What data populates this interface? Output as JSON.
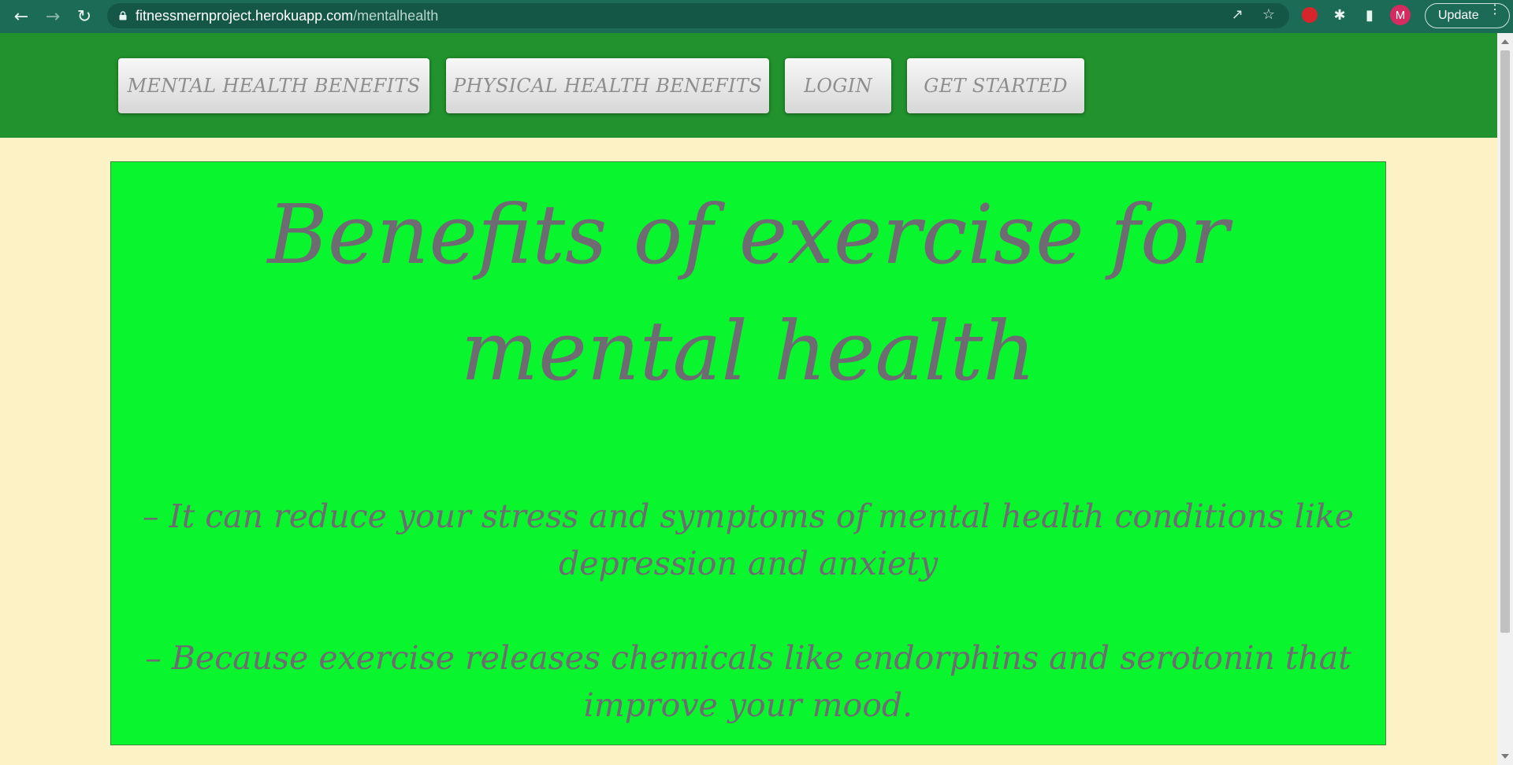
{
  "browser": {
    "url_domain": "fitnessmernproject.herokuapp.com",
    "url_path": "/mentalhealth",
    "avatar_letter": "M",
    "update_label": "Update",
    "icons": [
      "back-icon",
      "forward-icon",
      "reload-icon",
      "lock-icon",
      "share-icon",
      "star-icon",
      "extension-red-icon",
      "puzzle-icon",
      "sidepanel-icon",
      "menu-dots-icon"
    ]
  },
  "nav": {
    "buttons": [
      {
        "label": "MENTAL HEALTH BENEFITS"
      },
      {
        "label": "PHYSICAL HEALTH BENEFITS"
      },
      {
        "label": "LOGIN"
      },
      {
        "label": "GET STARTED"
      }
    ]
  },
  "main": {
    "title": "Benefits of exercise for mental health",
    "benefits": [
      "– It can reduce your stress and symptoms of mental health conditions like depression and anxiety",
      "– Because exercise releases chemicals like endorphins and serotonin that improve your mood."
    ]
  },
  "colors": {
    "chrome_bg": "#1c6b56",
    "nav_bg": "#21922d",
    "page_bg": "#fdf1c6",
    "card_bg": "#09f52d",
    "text_gray": "#6e6b72"
  }
}
